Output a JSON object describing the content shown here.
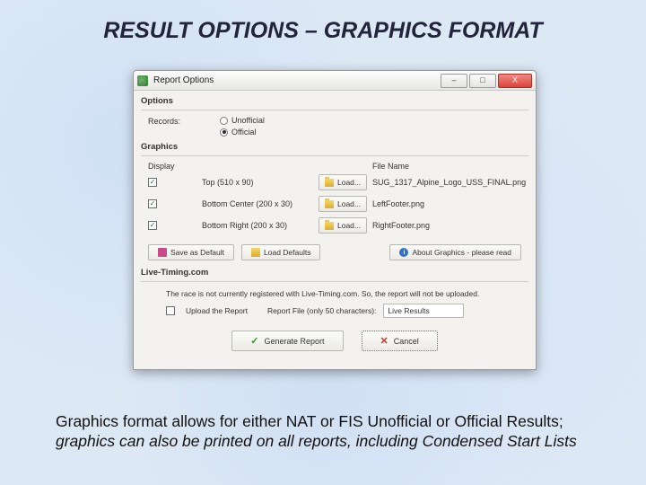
{
  "slide": {
    "title": "RESULT OPTIONS – GRAPHICS FORMAT",
    "caption_plain": "Graphics format allows for either NAT or FIS Unofficial or Official Results; ",
    "caption_italic": "graphics can also be printed on all reports, including Condensed Start Lists"
  },
  "window": {
    "title": "Report Options",
    "controls": {
      "min": "–",
      "max": "□",
      "close": "X"
    }
  },
  "options": {
    "group": "Options",
    "record_label": "Records:",
    "radios": [
      {
        "label": "Unofficial",
        "selected": false
      },
      {
        "label": "Official",
        "selected": true
      }
    ]
  },
  "graphics": {
    "group": "Graphics",
    "head_display": "Display",
    "head_file": "File Name",
    "rows": [
      {
        "label": "Top (510 x 90)",
        "btn": "Load...",
        "file": "SUG_1317_Alpine_Logo_USS_FINAL.png"
      },
      {
        "label": "Bottom Center (200 x 30)",
        "btn": "Load...",
        "file": "LeftFooter.png"
      },
      {
        "label": "Bottom Right (200 x 30)",
        "btn": "Load...",
        "file": "RightFooter.png"
      }
    ]
  },
  "defaults": {
    "save": "Save as Default",
    "load": "Load Defaults",
    "about": "About Graphics - please read"
  },
  "live": {
    "group": "Live-Timing.com",
    "status": "The race is not currently registered with Live-Timing.com. So, the report will not be uploaded.",
    "upload_label": "Upload the Report",
    "file_label": "Report File (only 50 characters):",
    "file_value": "Live Results"
  },
  "actions": {
    "generate": "Generate Report",
    "cancel": "Cancel"
  }
}
